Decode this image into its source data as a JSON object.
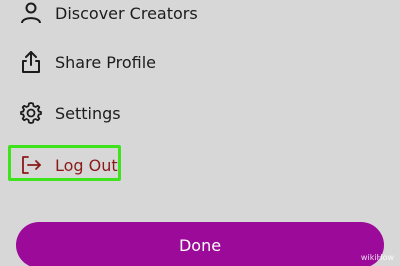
{
  "menu": {
    "items": [
      {
        "label": "Discover Creators",
        "icon": "person-icon"
      },
      {
        "label": "Share Profile",
        "icon": "share-icon"
      },
      {
        "label": "Settings",
        "icon": "gear-icon"
      },
      {
        "label": "Log Out",
        "icon": "logout-icon"
      }
    ]
  },
  "done_button": {
    "label": "Done"
  },
  "watermark": {
    "text": "wikiHow"
  },
  "colors": {
    "background": "#d7d7d7",
    "highlight": "#3ee31c",
    "done_button": "#9b0a99",
    "logout_text": "#8b1a1a"
  }
}
